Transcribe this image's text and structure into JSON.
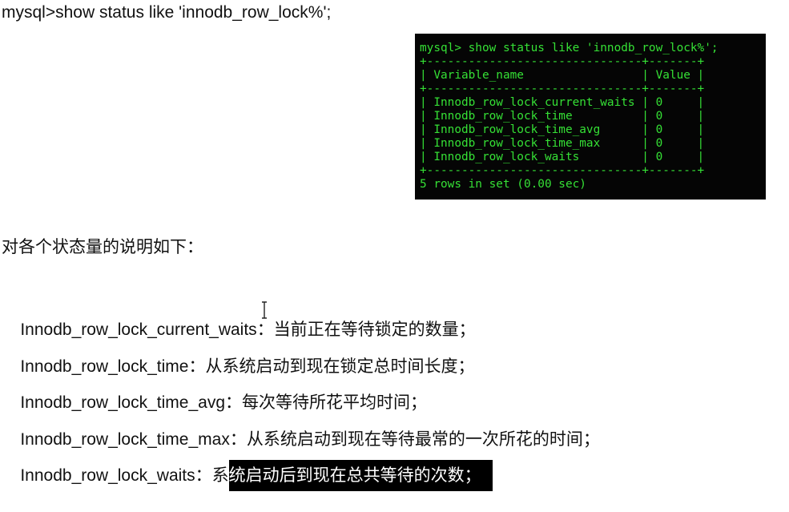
{
  "command": "mysql>show status like 'innodb_row_lock%';",
  "terminal": {
    "lines": [
      "mysql> show status like 'innodb_row_lock%';",
      "+-------------------------------+-------+",
      "| Variable_name                 | Value |",
      "+-------------------------------+-------+",
      "| Innodb_row_lock_current_waits | 0     |",
      "| Innodb_row_lock_time          | 0     |",
      "| Innodb_row_lock_time_avg      | 0     |",
      "| Innodb_row_lock_time_max      | 0     |",
      "| Innodb_row_lock_waits         | 0     |",
      "+-------------------------------+-------+",
      "5 rows in set (0.00 sec)"
    ],
    "text_color": "#35e035",
    "background_color": "#050505"
  },
  "intro": "对各个状态量的说明如下：",
  "descriptions": [
    {
      "name": "Innodb_row_lock_current_waits",
      "text": "：当前正在等待锁定的数量；"
    },
    {
      "name": "Innodb_row_lock_time",
      "text": "：从系统启动到现在锁定总时间长度；"
    },
    {
      "name": "Innodb_row_lock_time_avg",
      "text": "：每次等待所花平均时间；"
    },
    {
      "name": "Innodb_row_lock_time_max",
      "text": "：从系统启动到现在等待最常的一次所花的时间；"
    },
    {
      "name": "Innodb_row_lock_waits",
      "text_plain": "：系",
      "text_highlighted": "统启动后到现在总共等待的次数；"
    }
  ]
}
